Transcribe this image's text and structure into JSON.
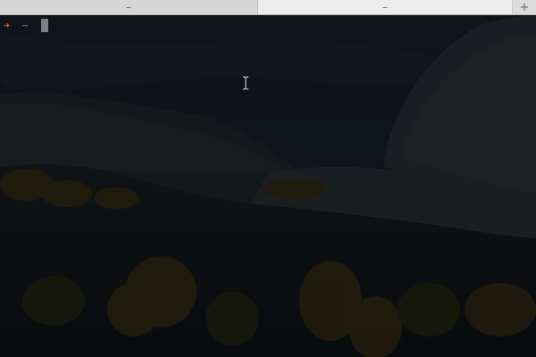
{
  "tabs": [
    {
      "title": "~"
    },
    {
      "title": "~"
    }
  ],
  "new_tab": {
    "symbol": "+"
  },
  "prompt": {
    "symbol": "➜",
    "cwd": "~"
  },
  "colors": {
    "prompt_arrow": "#f25d2c",
    "cwd": "#3fb3d9",
    "cursor": "#7d8288"
  },
  "icons": {
    "text_cursor": "i-beam-cursor-icon"
  }
}
